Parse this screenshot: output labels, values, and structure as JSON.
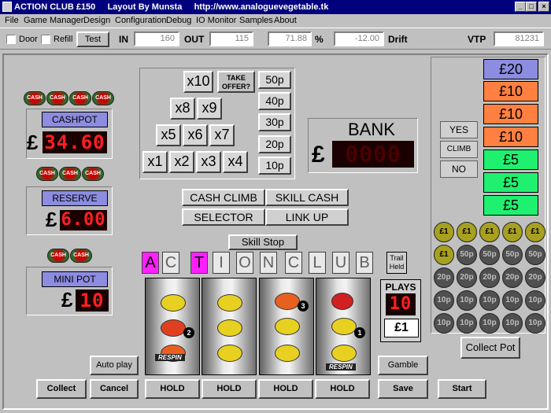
{
  "window": {
    "title": "ACTION CLUB £150     Layout By Munsta     http://www.analoguevegetable.tk",
    "buttons": [
      "_",
      "□",
      "×"
    ]
  },
  "menu": [
    "File",
    "Game Manager",
    "Design",
    "Configuration",
    "Debug",
    "IO Monitor",
    "Samples",
    "About"
  ],
  "toolbar": {
    "door_label": "Door",
    "refill_label": "Refill",
    "test_label": "Test",
    "in_label": "IN",
    "in_value": "160",
    "out_label": "OUT",
    "out_value": "115",
    "percent_value": "71.88",
    "percent_sign": "%",
    "drift_value": "-12.00",
    "drift_label": "Drift",
    "vtp_label": "VTP",
    "vtp_value": "81231"
  },
  "left": {
    "cashpot_label": "CASHPOT",
    "cashpot_value": "34.60",
    "reserve_label": "RESERVE",
    "reserve_value": "6.00",
    "minipot_label": "MINI POT",
    "minipot_value": "10",
    "pound": "£",
    "sticker_text": "CASH"
  },
  "multipliers": [
    "x10",
    "x8",
    "x9",
    "x5",
    "x6",
    "x7",
    "x1",
    "x2",
    "x3",
    "x4"
  ],
  "take_offer": "TAKE OFFER?",
  "stakes": [
    "50p",
    "40p",
    "30p",
    "20p",
    "10p"
  ],
  "bank": {
    "label": "BANK",
    "value": "0000",
    "pound": "£"
  },
  "features": [
    "CASH CLIMB",
    "SKILL CASH",
    "SELECTOR",
    "LINK UP"
  ],
  "skill_stop": "Skill Stop",
  "letters": [
    "A",
    "C",
    "T",
    "I",
    "O",
    "N",
    "C",
    "L",
    "U",
    "B"
  ],
  "trail_held": "Trail Held",
  "plays": {
    "label": "PLAYS",
    "value": "10",
    "stake": "£1"
  },
  "reels": {
    "respin": "RESPIN",
    "badges": [
      "2",
      "3",
      "1",
      "1"
    ]
  },
  "gamble": {
    "yes": "YES",
    "climb": "CLIMB",
    "no": "NO"
  },
  "notes": [
    "£20",
    "£10",
    "£10",
    "£10",
    "£5",
    "£5",
    "£5"
  ],
  "coins": [
    [
      "£1",
      "£1",
      "£1",
      "£1",
      "£1"
    ],
    [
      "£1",
      "50p",
      "50p",
      "50p",
      "50p"
    ],
    [
      "20p",
      "20p",
      "20p",
      "20p",
      "20p"
    ],
    [
      "10p",
      "10p",
      "10p",
      "10p",
      "10p"
    ],
    [
      "10p",
      "10p",
      "10p",
      "10p",
      "10p"
    ]
  ],
  "buttons": {
    "collect_pot": "Collect Pot",
    "auto_play": "Auto play",
    "gamble": "Gamble",
    "collect": "Collect",
    "cancel": "Cancel",
    "hold": "HOLD",
    "save": "Save",
    "start": "Start"
  },
  "colors": {
    "note_purple": "#8c8ce0",
    "note_orange": "#ff8040",
    "note_green": "#20f070",
    "letter_lit": "#ff20ff"
  }
}
